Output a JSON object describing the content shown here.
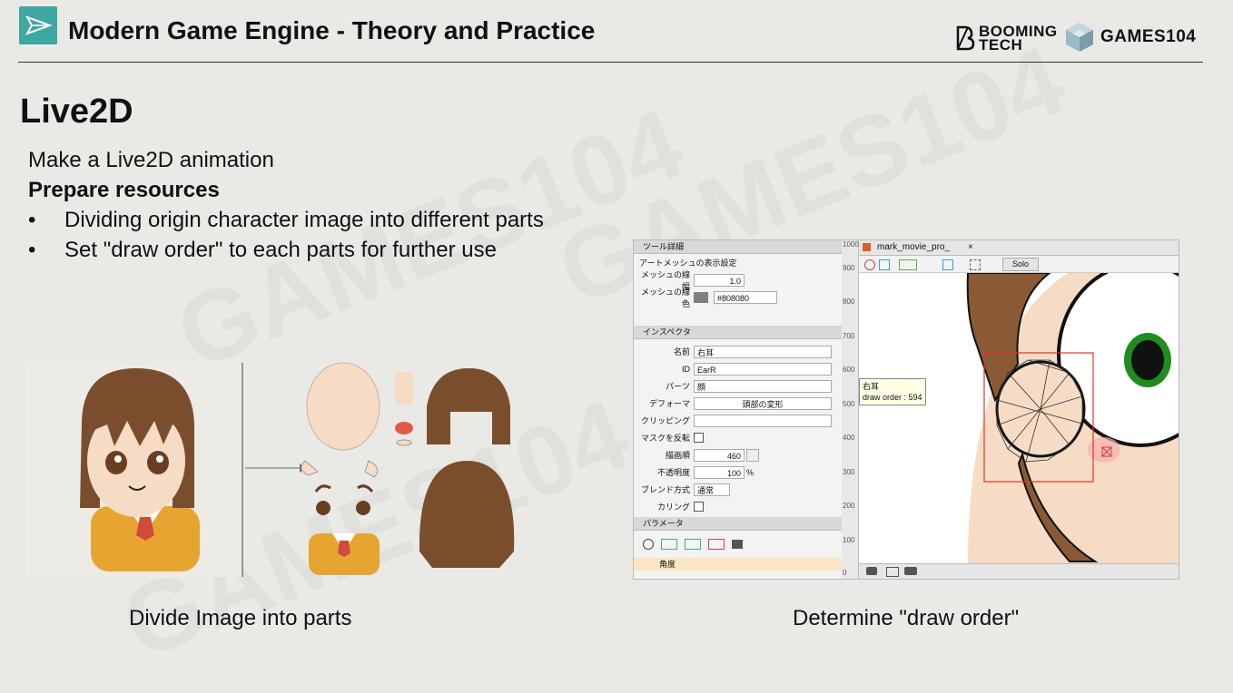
{
  "header": {
    "title": "Modern Game Engine - Theory and Practice",
    "brand1_line1": "BOOMING",
    "brand1_line2": "TECH",
    "brand2": "GAMES104"
  },
  "slide": {
    "title": "Live2D",
    "line1": "Make a Live2D animation",
    "line2": "Prepare resources",
    "bullets": [
      "Dividing origin character image into different parts",
      "Set \"draw order\" to each parts for further use"
    ],
    "bullet_symbol": "•",
    "caption_left": "Divide Image into parts",
    "caption_right": "Determine \"draw order\""
  },
  "editor": {
    "tool_tab": "ツール詳細",
    "mesh_section": "アートメッシュの表示設定",
    "mesh_width_label": "メッシュの線幅",
    "mesh_width_value": "1.0",
    "mesh_color_label": "メッシュの線色",
    "mesh_color_value": "#808080",
    "inspector_tab": "インスペクタ",
    "name_label": "名前",
    "name_value": "右耳",
    "id_label": "ID",
    "id_value": "EarR",
    "parts_label": "パーツ",
    "parts_value": "顔",
    "deformer_label": "デフォーマ",
    "deformer_value": "頭部の変形",
    "clipping_label": "クリッピング",
    "invert_mask_label": "マスクを反転",
    "draw_order_label": "描画順",
    "draw_order_value": "460",
    "opacity_label": "不透明度",
    "opacity_value": "100",
    "opacity_unit": "%",
    "blend_label": "ブレンド方式",
    "blend_value": "通常",
    "culling_label": "カリング",
    "params_tab": "パラメータ",
    "param_row": "角度",
    "canvas_tab": "mark_movie_pro_",
    "solo_label": "Solo",
    "tooltip_line1": "右耳",
    "tooltip_line2": "draw order : 594",
    "ruler_ticks": [
      "1000",
      "900",
      "800",
      "700",
      "600",
      "500",
      "400",
      "300",
      "200",
      "100",
      "0"
    ]
  },
  "colors": {
    "accent": "#3fa7a1",
    "hair": "#7a4e2d",
    "skin": "#f6dcc4",
    "uniform": "#e6a530",
    "selection": "#d9382b",
    "eye_green": "#1f8c1f"
  }
}
